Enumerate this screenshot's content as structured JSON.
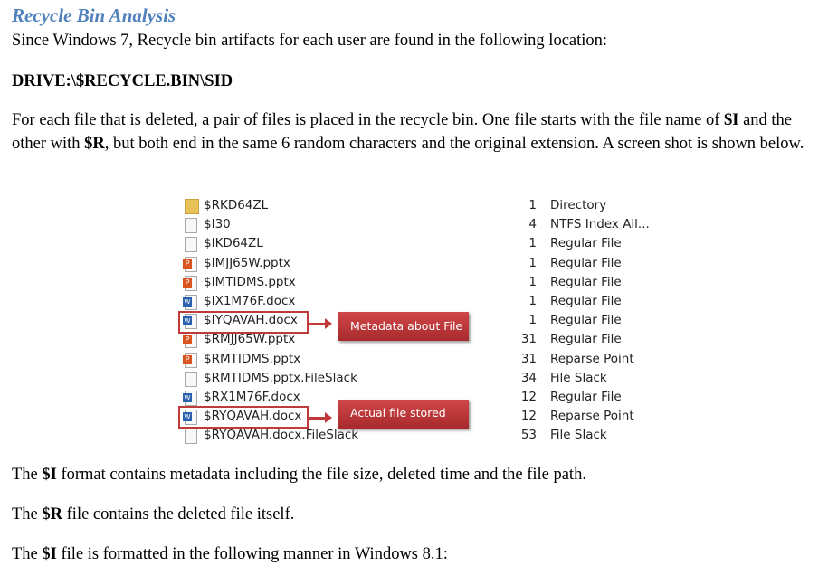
{
  "title": "Recycle Bin Analysis",
  "intro": "Since Windows 7, Recycle bin artifacts for each user are found in the following location:",
  "path": "DRIVE:\\$RECYCLE.BIN\\SID",
  "para": {
    "t1": "For each file that is deleted, a pair of files is placed in the recycle bin. One file starts with the file name of ",
    "b1": "$I",
    "t2": " and the other with ",
    "b2": "$R",
    "t3": ", but both end in the same 6 random characters and the original extension. A screen shot is shown below."
  },
  "files": [
    {
      "name": "$RKD64ZL",
      "count": "1",
      "type": "Directory",
      "icon": "folder-icon"
    },
    {
      "name": "$I30",
      "count": "4",
      "type": "NTFS Index All...",
      "icon": "file-icon"
    },
    {
      "name": "$IKD64ZL",
      "count": "1",
      "type": "Regular File",
      "icon": "file-icon"
    },
    {
      "name": "$IMJJ65W.pptx",
      "count": "1",
      "type": "Regular File",
      "icon": "powerpoint-icon"
    },
    {
      "name": "$IMTIDMS.pptx",
      "count": "1",
      "type": "Regular File",
      "icon": "powerpoint-icon"
    },
    {
      "name": "$IX1M76F.docx",
      "count": "1",
      "type": "Regular File",
      "icon": "word-icon"
    },
    {
      "name": "$IYQAVAH.docx",
      "count": "1",
      "type": "Regular File",
      "icon": "word-icon"
    },
    {
      "name": "$RMJJ65W.pptx",
      "count": "31",
      "type": "Regular File",
      "icon": "powerpoint-icon"
    },
    {
      "name": "$RMTIDMS.pptx",
      "count": "31",
      "type": "Reparse Point",
      "icon": "powerpoint-icon"
    },
    {
      "name": "$RMTIDMS.pptx.FileSlack",
      "count": "34",
      "type": "File Slack",
      "icon": "file-icon"
    },
    {
      "name": "$RX1M76F.docx",
      "count": "12",
      "type": "Regular File",
      "icon": "word-icon"
    },
    {
      "name": "$RYQAVAH.docx",
      "count": "12",
      "type": "Reparse Point",
      "icon": "word-icon"
    },
    {
      "name": "$RYQAVAH.docx.FileSlack",
      "count": "53",
      "type": "File Slack",
      "icon": "file-icon"
    }
  ],
  "callouts": {
    "metadata": "Metadata about File",
    "actual": "Actual file stored"
  },
  "s1": {
    "t1": "The ",
    "b": "$I",
    "t2": " format contains metadata including the file size, deleted time and the file path."
  },
  "s2": {
    "t1": "The ",
    "b": "$R",
    "t2": " file contains the deleted file itself."
  },
  "s3": {
    "t1": "The ",
    "b": "$I",
    "t2": " file is formatted in the following manner in Windows 8.1:"
  },
  "colors": {
    "title": "#4f81bd",
    "highlight": "#c0393b"
  }
}
